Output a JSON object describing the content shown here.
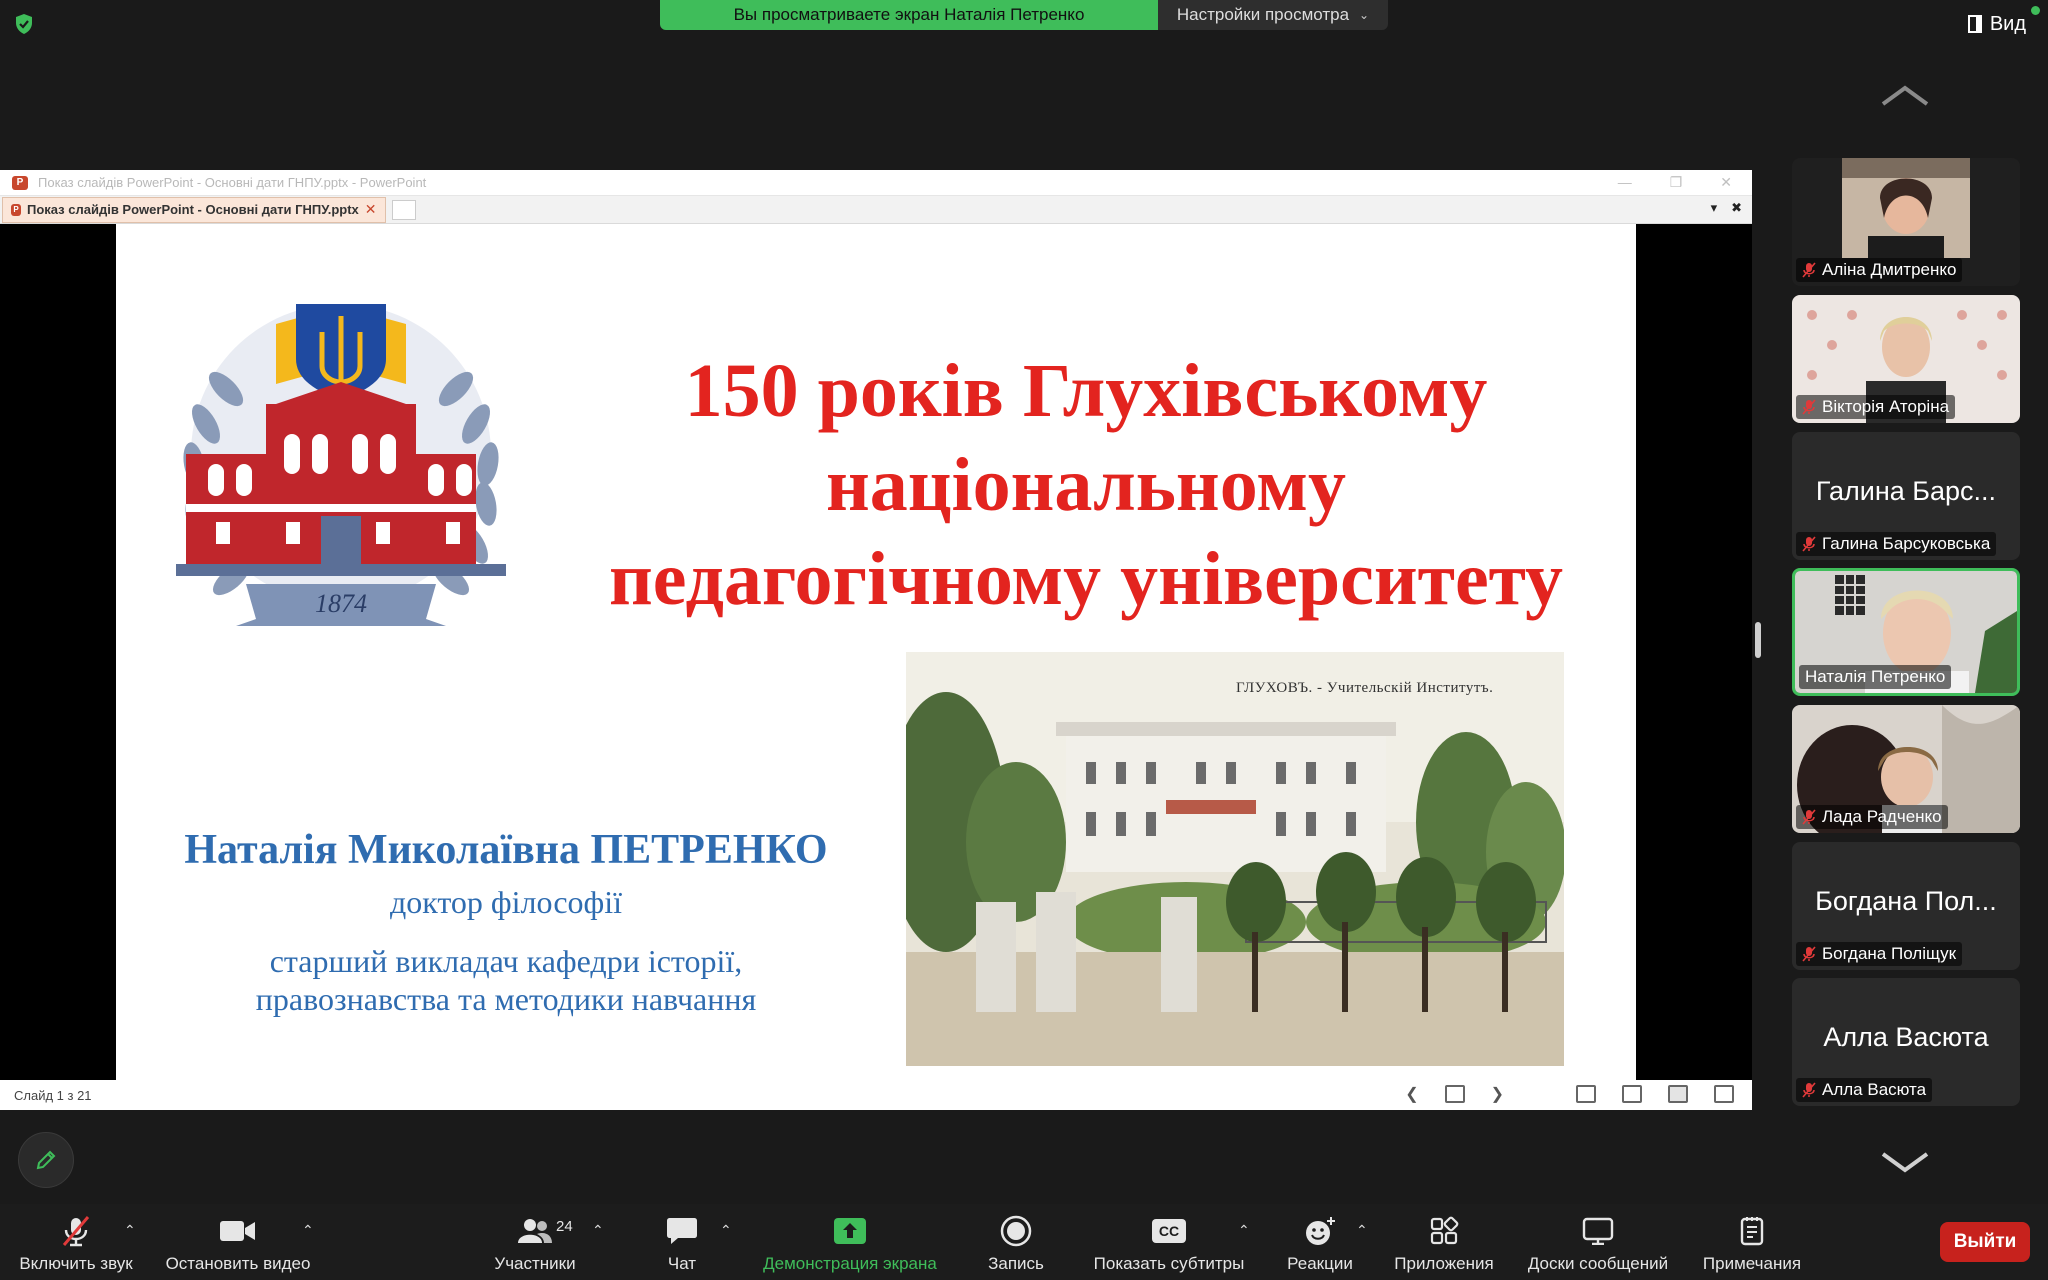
{
  "top": {
    "share_banner": "Вы просматриваете экран Наталія Петренко",
    "view_options": "Настройки просмотра",
    "view_button": "Вид"
  },
  "window": {
    "title": "Показ слайдів PowerPoint  -  Основні дати ГНПУ.pptx - PowerPoint",
    "tab_label": "Показ слайдів PowerPoint  -  Основні дати ГНПУ.pptx",
    "status": "Слайд 1 з 21"
  },
  "slide": {
    "title_lines": [
      "150 років Глухівському",
      "національному",
      "педагогічному університету"
    ],
    "logo_year": "1874",
    "author_name": "Наталія Миколаївна ПЕТРЕНКО",
    "author_degree": "доктор філософії",
    "author_position_lines": [
      "старший викладач кафедри історії,",
      "правознавства та методики навчання"
    ],
    "photo_caption": "ГЛУХОВЪ. - Учительскiй Институтъ."
  },
  "participants": [
    {
      "name": "Аліна Дмитренко",
      "big": "",
      "muted": true,
      "video": true
    },
    {
      "name": "Вікторія Аторіна",
      "big": "",
      "muted": true,
      "video": true
    },
    {
      "name": "Галина Барсуковська",
      "big": "Галина Барс...",
      "muted": true,
      "video": false
    },
    {
      "name": "Наталія Петренко",
      "big": "",
      "muted": false,
      "video": true,
      "active": true
    },
    {
      "name": "Лада Радченко",
      "big": "",
      "muted": true,
      "video": true
    },
    {
      "name": "Богдана Поліщук",
      "big": "Богдана Пол...",
      "muted": true,
      "video": false
    },
    {
      "name": "Алла Васюта",
      "big": "Алла Васюта",
      "muted": true,
      "video": false
    }
  ],
  "toolbar": {
    "unmute": "Включить звук",
    "stop_video": "Остановить видео",
    "participants": "Участники",
    "participants_count": "24",
    "chat": "Чат",
    "share": "Демонстрация экрана",
    "record": "Запись",
    "captions": "Показать субтитры",
    "captions_icon": "CC",
    "reactions": "Реакции",
    "apps": "Приложения",
    "whiteboards": "Доски сообщений",
    "notes": "Примечания",
    "leave": "Выйти"
  },
  "colors": {
    "accent_green": "#3fbd5a",
    "slide_title_red": "#e3241f",
    "slide_text_blue": "#2f6cb0",
    "leave_red": "#c7221d"
  }
}
